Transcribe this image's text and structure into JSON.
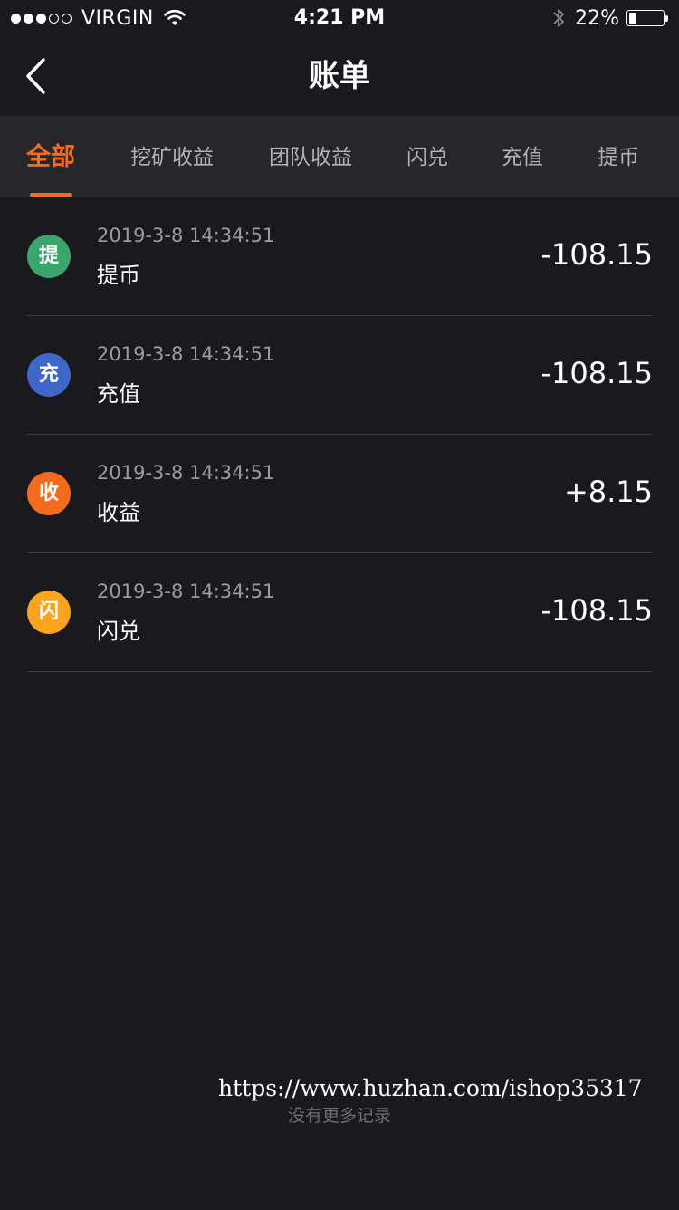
{
  "status_bar": {
    "carrier": "VIRGIN",
    "time": "4:21 PM",
    "battery_percent": "22%",
    "battery_level": 0.22,
    "signal_bars_filled": 3,
    "signal_bars_total": 5
  },
  "nav": {
    "title": "账单",
    "back_icon": "chevron-left-icon"
  },
  "tabs": [
    {
      "label": "全部",
      "active": true
    },
    {
      "label": "挖矿收益",
      "active": false
    },
    {
      "label": "团队收益",
      "active": false
    },
    {
      "label": "闪兑",
      "active": false
    },
    {
      "label": "充值",
      "active": false
    },
    {
      "label": "提币",
      "active": false
    }
  ],
  "records": [
    {
      "icon_char": "提",
      "icon_color": "#3aa56c",
      "time": "2019-3-8 14:34:51",
      "type": "提币",
      "amount": "-108.15"
    },
    {
      "icon_char": "充",
      "icon_color": "#3e67c9",
      "time": "2019-3-8 14:34:51",
      "type": "充值",
      "amount": "-108.15"
    },
    {
      "icon_char": "收",
      "icon_color": "#f56b1d",
      "time": "2019-3-8 14:34:51",
      "type": "收益",
      "amount": "+8.15"
    },
    {
      "icon_char": "闪",
      "icon_color": "#f9a31f",
      "time": "2019-3-8 14:34:51",
      "type": "闪兑",
      "amount": "-108.15"
    }
  ],
  "footer": {
    "watermark": "https://www.huzhan.com/ishop35317",
    "no_more_text": "没有更多记录"
  },
  "colors": {
    "background": "#1a191e",
    "tab_bar": "#27272b",
    "accent": "#f56b1d"
  }
}
